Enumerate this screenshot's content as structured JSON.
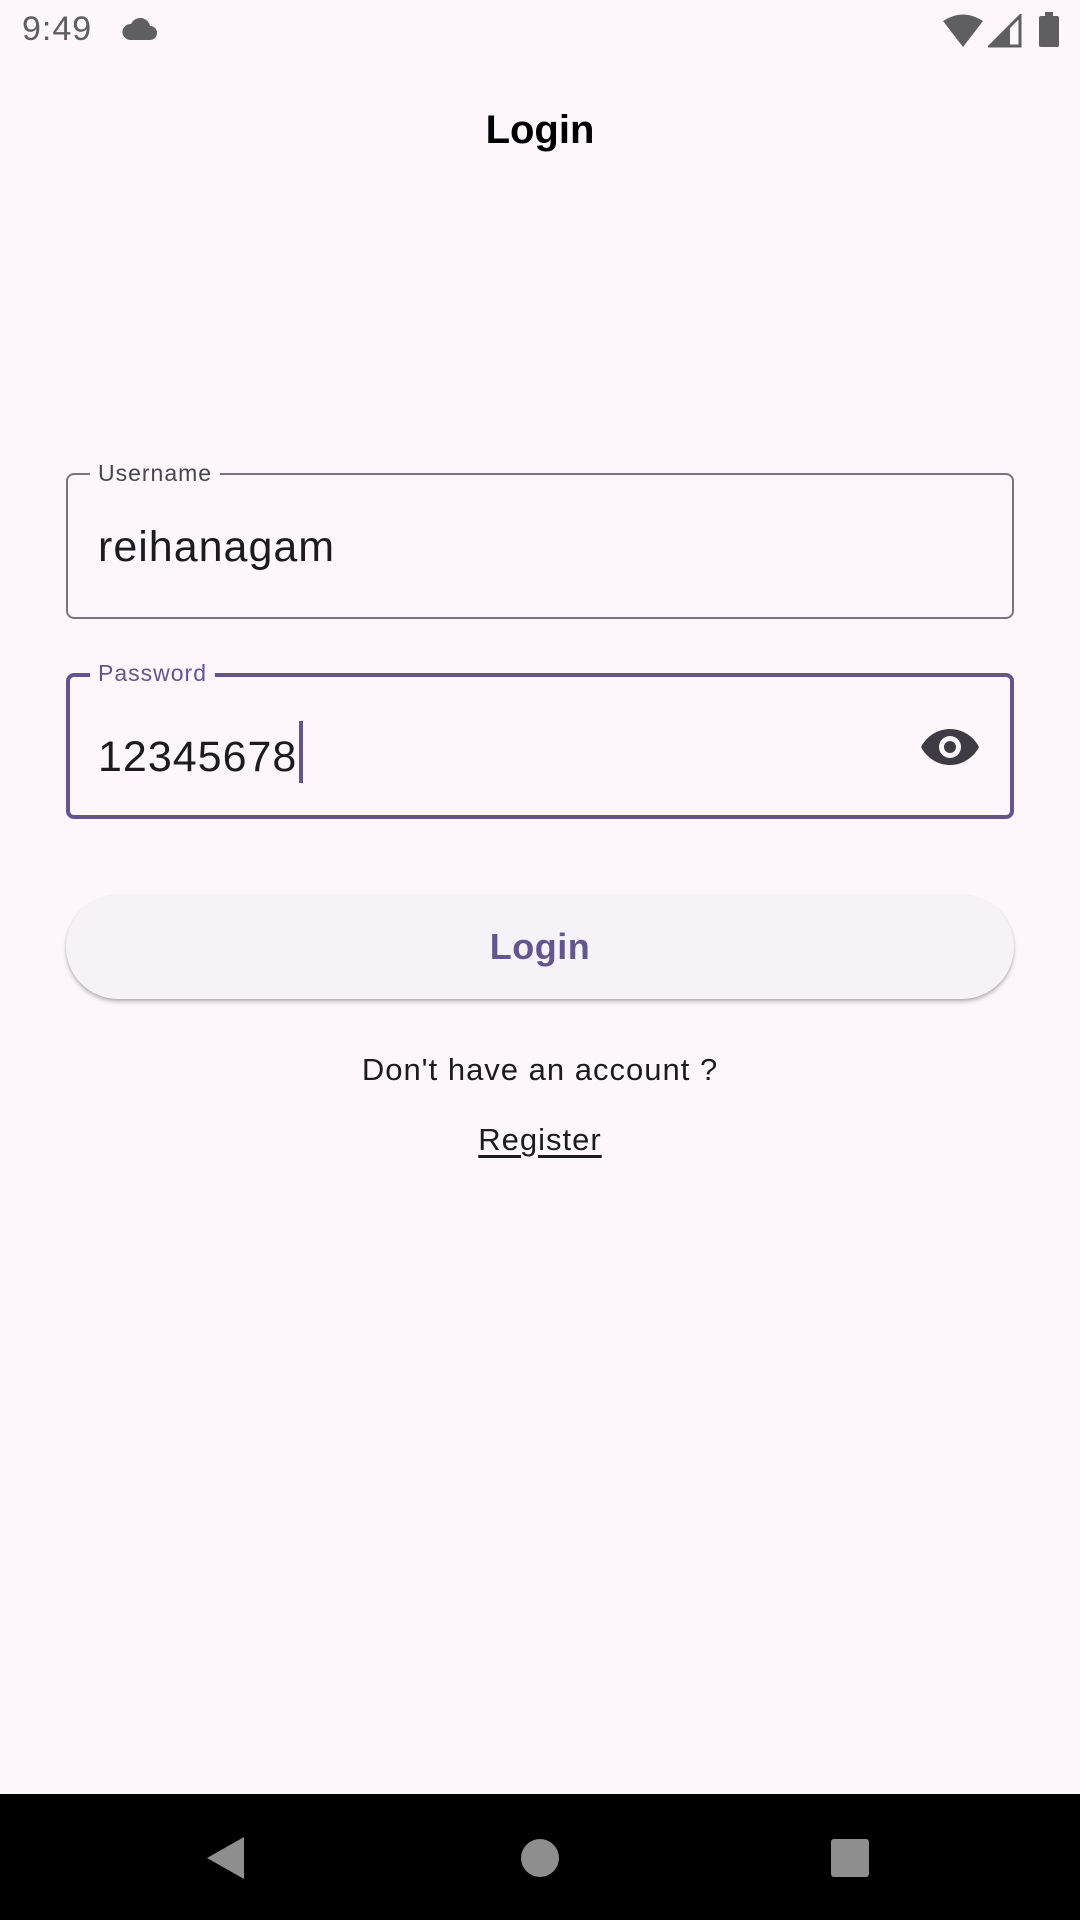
{
  "status_bar": {
    "time": "9:49",
    "icons": [
      "cloud-icon",
      "wifi-icon",
      "signal-icon",
      "battery-icon"
    ]
  },
  "app_bar": {
    "title": "Login"
  },
  "form": {
    "username": {
      "label": "Username",
      "value": "reihanagam"
    },
    "password": {
      "label": "Password",
      "value": "12345678",
      "focused": true,
      "toggle_icon": "eye-icon"
    },
    "login_button_label": "Login",
    "account_prompt": "Don't have an account ?",
    "register_link": "Register"
  },
  "nav_bar": {
    "buttons": [
      "back-icon",
      "home-icon",
      "recents-icon"
    ]
  },
  "colors": {
    "background": "#FDF7FC",
    "primary": "#65558F",
    "outline": "#79747E",
    "on_surface": "#1C1B1F"
  }
}
